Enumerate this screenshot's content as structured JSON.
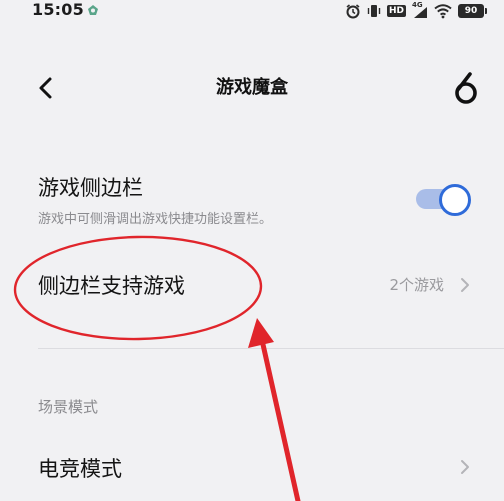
{
  "status_bar": {
    "time": "15:05",
    "hd_label": "HD",
    "network_label": "4G",
    "battery_level": "90"
  },
  "header": {
    "title": "游戏魔盒"
  },
  "settings": {
    "game_sidebar": {
      "title": "游戏侧边栏",
      "subtitle": "游戏中可侧滑调出游戏快捷功能设置栏。",
      "enabled": true
    },
    "sidebar_supported_games": {
      "title": "侧边栏支持游戏",
      "value": "2个游戏"
    },
    "scene_mode_section": {
      "label": "场景模式"
    },
    "esports_mode": {
      "title": "电竞模式"
    }
  },
  "colors": {
    "toggle_on": "#2f6bd9",
    "toggle_track": "#a9bde8",
    "annotation": "#e0252b"
  }
}
